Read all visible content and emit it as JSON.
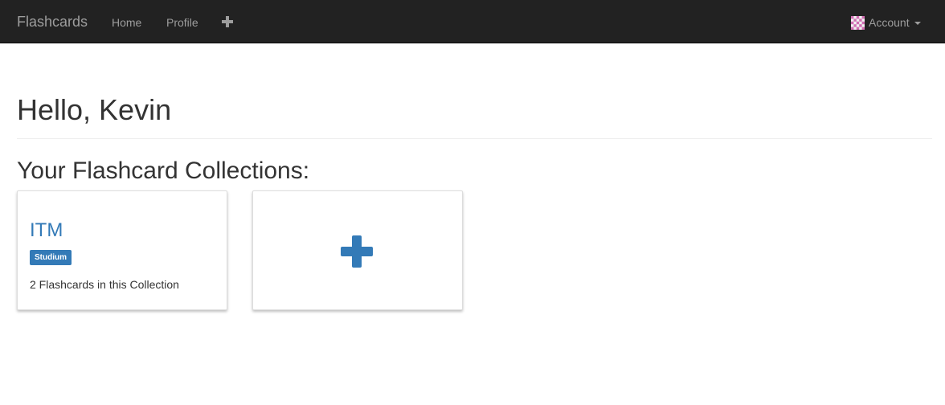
{
  "navbar": {
    "brand": "Flashcards",
    "links": [
      "Home",
      "Profile"
    ],
    "add_icon": "plus-icon",
    "account_label": "Account",
    "avatar_icon": "identicon-avatar",
    "caret_icon": "caret-down-icon"
  },
  "main": {
    "greeting": "Hello, Kevin",
    "collections_heading": "Your Flashcard Collections:",
    "collections": [
      {
        "title": "ITM",
        "tag": "Studium",
        "count_text": "2 Flashcards in this Collection"
      }
    ],
    "add_card_icon": "plus-icon"
  },
  "colors": {
    "navbar_bg": "#222222",
    "navbar_text": "#9d9d9d",
    "accent": "#337ab7",
    "avatar_pink": "#d16fb3"
  }
}
